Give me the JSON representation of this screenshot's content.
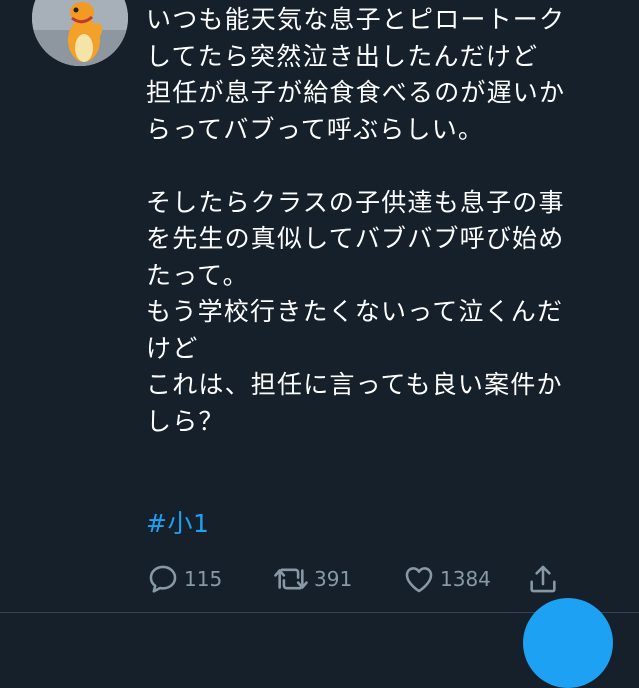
{
  "tweet": {
    "lines": [
      "いつも能天気な息子とピロートーク",
      "してたら突然泣き出したんだけど",
      "担任が息子が給食食べるのが遅いか",
      "らってバブって呼ぶらしい。",
      "",
      "そしたらクラスの子供達も息子の事",
      "を先生の真似してバブバブ呼び始め",
      "たって。",
      "もう学校行きたくないって泣くんだ",
      "けど",
      "これは、担任に言っても良い案件か",
      "しら？"
    ],
    "hashtag": "#小1"
  },
  "actions": {
    "reply_count": "115",
    "retweet_count": "391",
    "like_count": "1384"
  },
  "icons": {
    "reply": "reply-icon",
    "retweet": "retweet-icon",
    "like": "heart-icon",
    "share": "share-icon"
  },
  "colors": {
    "background": "#15202b",
    "text": "#ffffff",
    "muted": "#8899a6",
    "accent": "#1da1f2"
  }
}
